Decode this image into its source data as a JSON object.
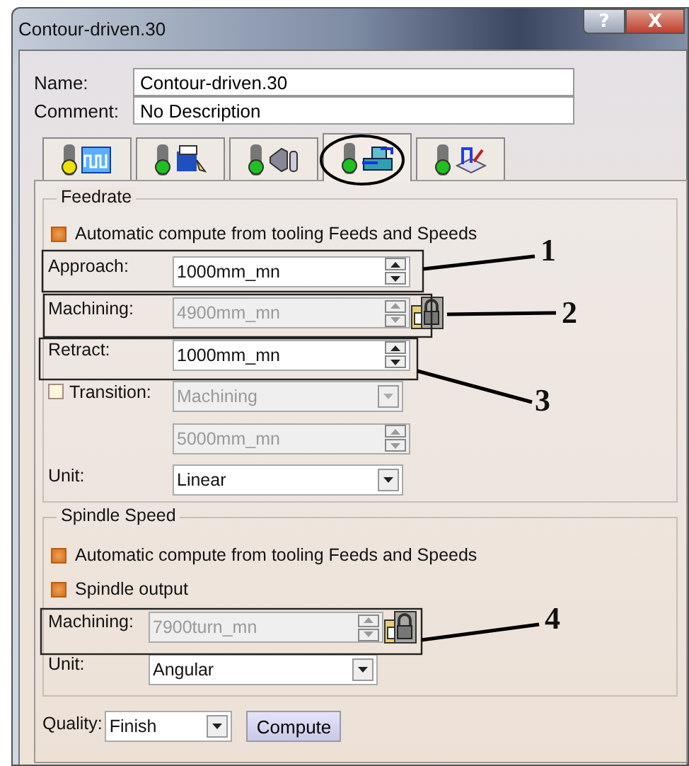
{
  "window": {
    "title": "Contour-driven.30",
    "buttons": [
      {
        "kind": "help",
        "label": "?"
      },
      {
        "kind": "close",
        "label": "X"
      }
    ]
  },
  "name": {
    "label": "Name:",
    "value": "Contour-driven.30"
  },
  "comment": {
    "label": "Comment:",
    "value": "No Description"
  },
  "tabs": [
    {
      "kind": "strategy",
      "selected": false,
      "color": "#f0e000"
    },
    {
      "kind": "geometry",
      "selected": false,
      "color": "#20c020"
    },
    {
      "kind": "tool",
      "selected": false,
      "color": "#20c020"
    },
    {
      "kind": "feeds",
      "selected": true,
      "color": "#20c020"
    },
    {
      "kind": "macros",
      "selected": false,
      "color": "#20c020"
    }
  ],
  "feedrate": {
    "title": "Feedrate",
    "auto": {
      "label": "Automatic compute from tooling Feeds and Speeds",
      "checked": true
    },
    "rows": [
      {
        "kind": "spinner",
        "label": "Approach:",
        "value": "1000mm_mn",
        "disabled": false,
        "locked": false
      },
      {
        "kind": "spinner",
        "label": "Machining:",
        "value": "4900mm_mn",
        "disabled": true,
        "locked": true
      },
      {
        "kind": "spinner",
        "label": "Retract:",
        "value": "1000mm_mn",
        "disabled": false,
        "locked": false
      },
      {
        "kind": "check-combo",
        "label": "Transition:",
        "checked": false,
        "value": "Machining",
        "disabled": true
      },
      {
        "kind": "spinner",
        "value": "5000mm_mn",
        "disabled": true,
        "locked": false
      },
      {
        "kind": "combo",
        "label": "Unit:",
        "value": "Linear",
        "disabled": false
      }
    ]
  },
  "spindle": {
    "title": "Spindle Speed",
    "checks": [
      {
        "label": "Automatic compute from tooling Feeds and Speeds",
        "checked": true
      },
      {
        "label": "Spindle output",
        "checked": true
      }
    ],
    "rows": [
      {
        "kind": "spinner",
        "label": "Machining:",
        "value": "7900turn_mn",
        "disabled": true,
        "locked": true
      },
      {
        "kind": "combo",
        "label": "Unit:",
        "value": "Angular",
        "disabled": false
      }
    ]
  },
  "quality": {
    "label": "Quality:",
    "value": "Finish"
  },
  "compute_button": "Compute",
  "callouts": [
    {
      "label": "1"
    },
    {
      "label": "2"
    },
    {
      "label": "3"
    },
    {
      "label": "4"
    }
  ]
}
